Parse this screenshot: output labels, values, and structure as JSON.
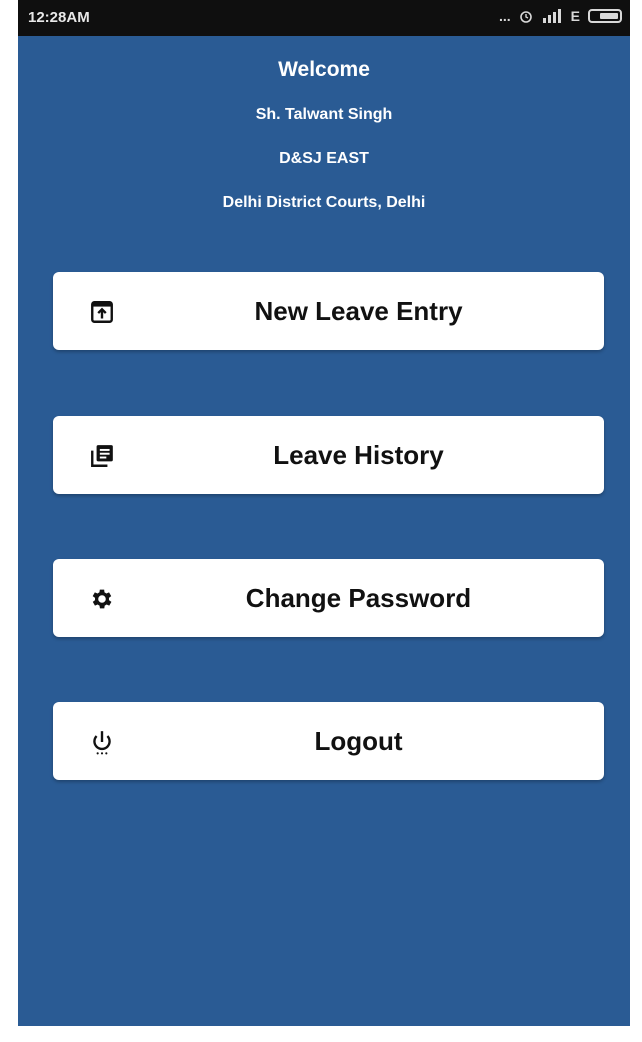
{
  "status_bar": {
    "time": "12:28AM",
    "signal_text": "... ",
    "network": "E"
  },
  "header": {
    "welcome": "Welcome",
    "user_name": "Sh. Talwant Singh",
    "designation": "D&SJ EAST",
    "court": "Delhi District Courts, Delhi"
  },
  "menu": {
    "new_leave_entry": "New Leave Entry",
    "leave_history": "Leave History",
    "change_password": "Change Password",
    "logout": "Logout"
  },
  "icons": {
    "new_leave_entry": "upload-box-icon",
    "leave_history": "library-books-icon",
    "change_password": "gear-icon",
    "logout": "power-icon"
  },
  "colors": {
    "background": "#2a5b94",
    "button_bg": "#ffffff",
    "text_dark": "#111111",
    "status_bar": "#0f0f0f"
  }
}
